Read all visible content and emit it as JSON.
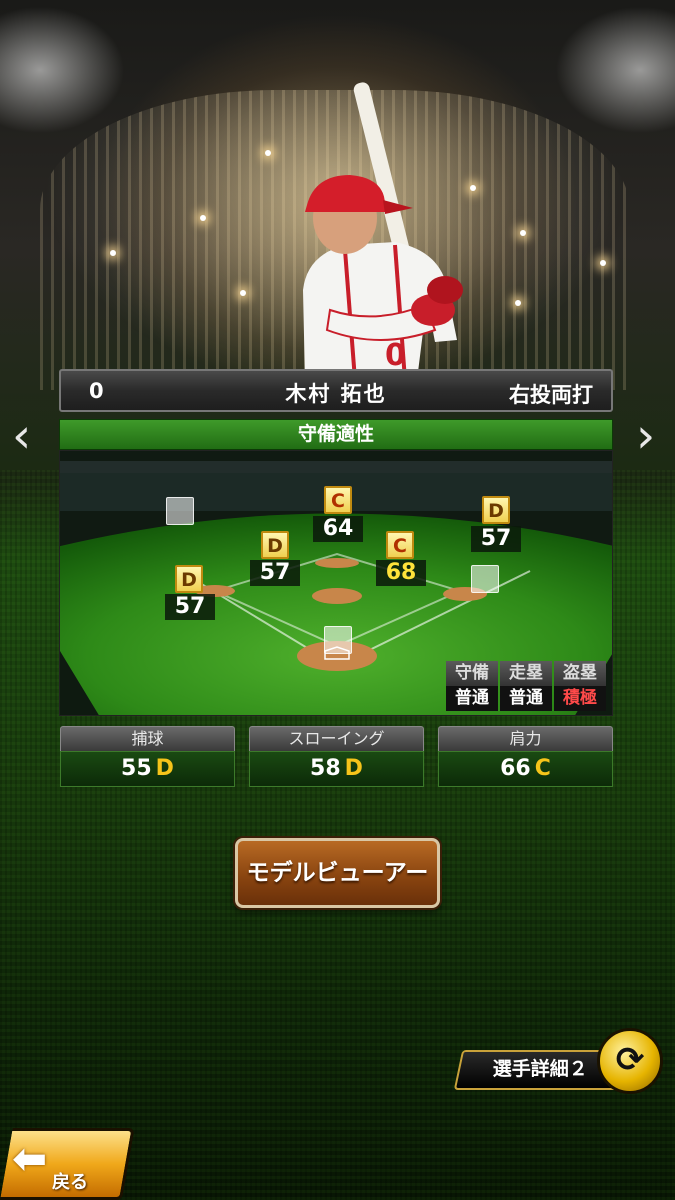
{
  "player": {
    "number": "0",
    "name": "木村 拓也",
    "handedness": "右投両打"
  },
  "nav": {
    "prev_icon": "‹",
    "next_icon": "›"
  },
  "defense": {
    "title": "守備適性",
    "positions": [
      {
        "pos": "pitcher",
        "grade": "",
        "value": ""
      },
      {
        "pos": "catcher",
        "grade": "",
        "value": ""
      },
      {
        "pos": "first",
        "grade": "",
        "value": ""
      },
      {
        "pos": "second",
        "grade": "C",
        "value": "68",
        "highlight": true
      },
      {
        "pos": "third",
        "grade": "D",
        "value": "57"
      },
      {
        "pos": "shortstop",
        "grade": "D",
        "value": "57"
      },
      {
        "pos": "left",
        "grade": "",
        "value": ""
      },
      {
        "pos": "center",
        "grade": "C",
        "value": "64"
      },
      {
        "pos": "right",
        "grade": "D",
        "value": "57"
      }
    ],
    "mini_table": {
      "headers": [
        "守備",
        "走塁",
        "盗塁"
      ],
      "values": [
        "普通",
        "普通",
        "積極"
      ]
    }
  },
  "stats": {
    "catching": {
      "label": "捕球",
      "value": "55",
      "grade": "D"
    },
    "throwing": {
      "label": "スローイング",
      "value": "58",
      "grade": "D"
    },
    "arm": {
      "label": "肩力",
      "value": "66",
      "grade": "C"
    }
  },
  "buttons": {
    "model_viewer": "モデルビューアー",
    "player_detail": "選手詳細２",
    "back": "戻る"
  },
  "icons": {
    "cycle": "cycle-arrows-icon",
    "back": "back-arrow-icon"
  }
}
